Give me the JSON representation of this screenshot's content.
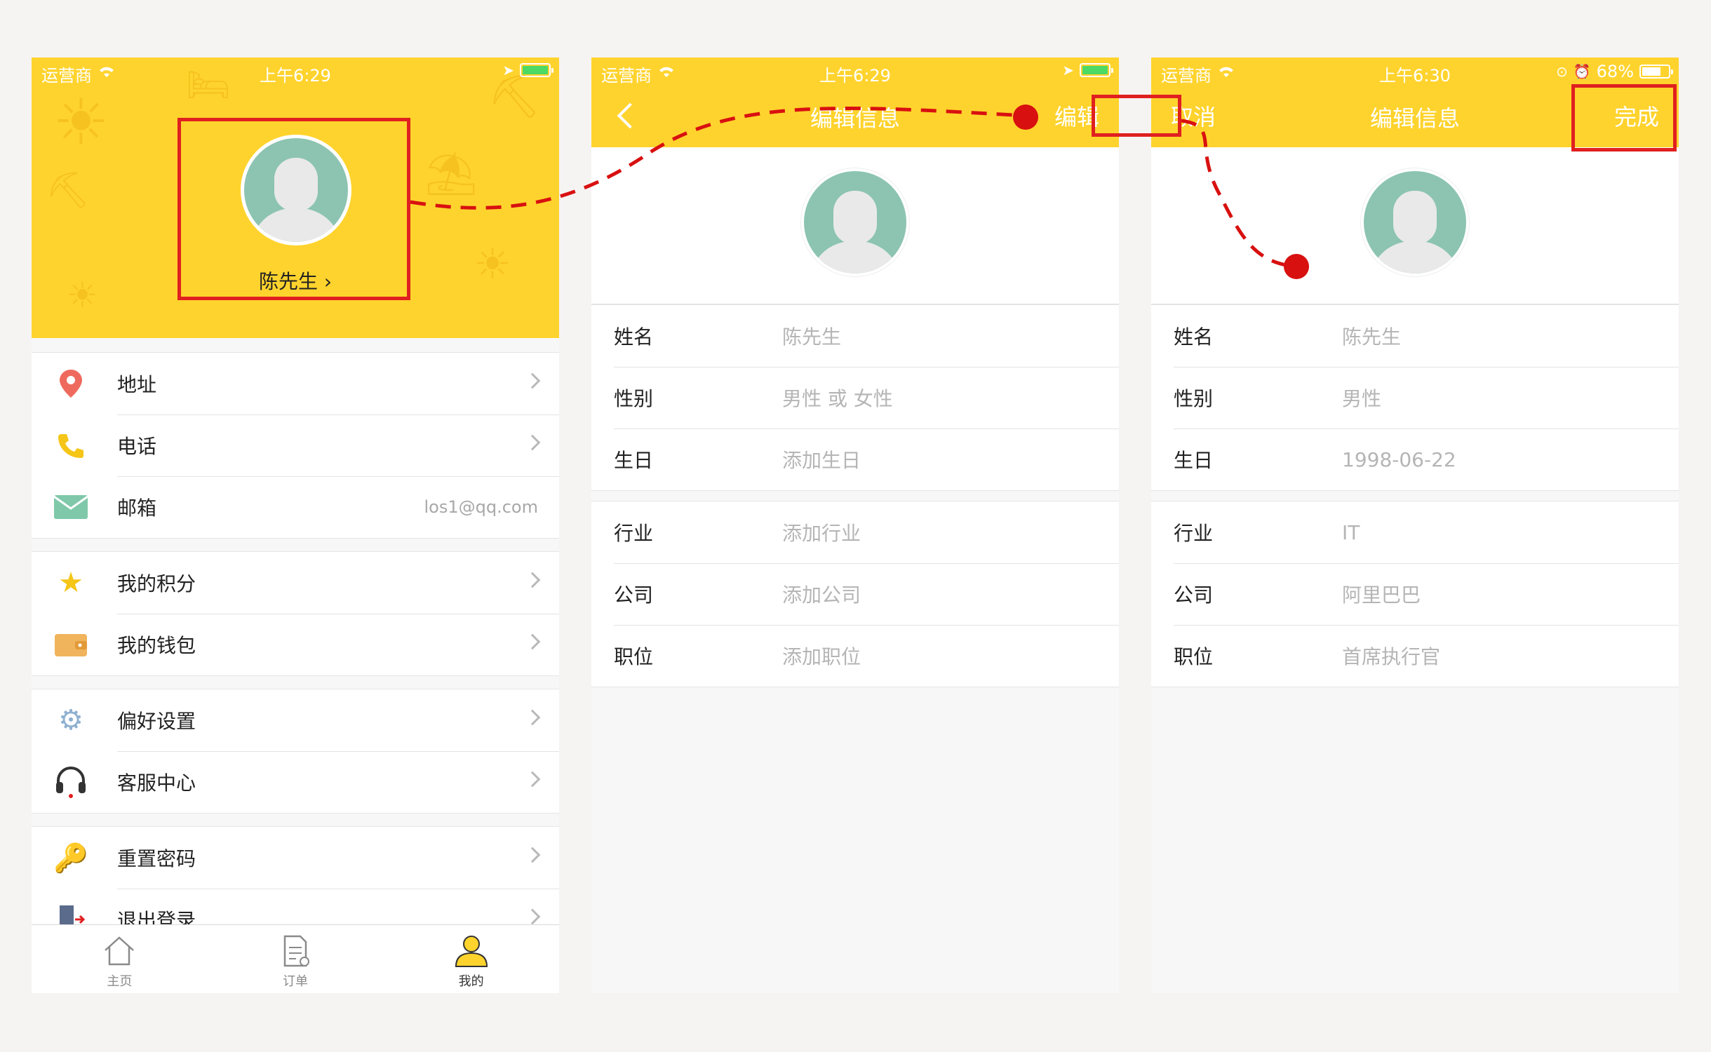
{
  "screen1": {
    "status": {
      "carrier": "运营商",
      "time": "上午6:29"
    },
    "profile_name": "陈先生 ›",
    "menu_groups": [
      [
        {
          "label": "地址",
          "icon": "location-pin-icon",
          "glyph": "📍",
          "chevron": true
        },
        {
          "label": "电话",
          "icon": "phone-icon",
          "glyph": "📞",
          "chevron": true
        },
        {
          "label": "邮箱",
          "icon": "mail-icon",
          "glyph": "✉",
          "value": "los1@qq.com",
          "chevron": false
        }
      ],
      [
        {
          "label": "我的积分",
          "icon": "star-icon",
          "glyph": "★",
          "chevron": true
        },
        {
          "label": "我的钱包",
          "icon": "wallet-icon",
          "glyph": "👛",
          "chevron": true
        }
      ],
      [
        {
          "label": "偏好设置",
          "icon": "gear-icon",
          "glyph": "⚙",
          "chevron": true
        },
        {
          "label": "客服中心",
          "icon": "headset-icon",
          "glyph": "🎧",
          "chevron": true
        }
      ],
      [
        {
          "label": "重置密码",
          "icon": "key-icon",
          "glyph": "🔑",
          "chevron": true
        },
        {
          "label": "退出登录",
          "icon": "logout-icon",
          "glyph": "🚪",
          "chevron": true
        }
      ]
    ],
    "tabs": [
      {
        "label": "主页",
        "icon": "home-icon"
      },
      {
        "label": "订单",
        "icon": "order-icon"
      },
      {
        "label": "我的",
        "icon": "profile-icon"
      }
    ]
  },
  "screen2": {
    "status": {
      "carrier": "运营商",
      "time": "上午6:29"
    },
    "title": "编辑信息",
    "edit_button": "编辑",
    "fields_group1": [
      {
        "label": "姓名",
        "value": "陈先生"
      },
      {
        "label": "性别",
        "value": "男性 或 女性"
      },
      {
        "label": "生日",
        "value": "添加生日"
      }
    ],
    "fields_group2": [
      {
        "label": "行业",
        "value": "添加行业"
      },
      {
        "label": "公司",
        "value": "添加公司"
      },
      {
        "label": "职位",
        "value": "添加职位"
      }
    ]
  },
  "screen3": {
    "status": {
      "carrier": "运营商",
      "time": "上午6:30",
      "battery": "68%"
    },
    "title": "编辑信息",
    "cancel_button": "取消",
    "done_button": "完成",
    "fields_group1": [
      {
        "label": "姓名",
        "value": "陈先生"
      },
      {
        "label": "性别",
        "value": "男性"
      },
      {
        "label": "生日",
        "value": "1998-06-22"
      }
    ],
    "fields_group2": [
      {
        "label": "行业",
        "value": "IT"
      },
      {
        "label": "公司",
        "value": "阿里巴巴"
      },
      {
        "label": "职位",
        "value": "首席执行官"
      }
    ]
  },
  "colors": {
    "accent": "#ffd32d",
    "annotation": "#e02020",
    "avatar_bg": "#8cc4b1"
  }
}
